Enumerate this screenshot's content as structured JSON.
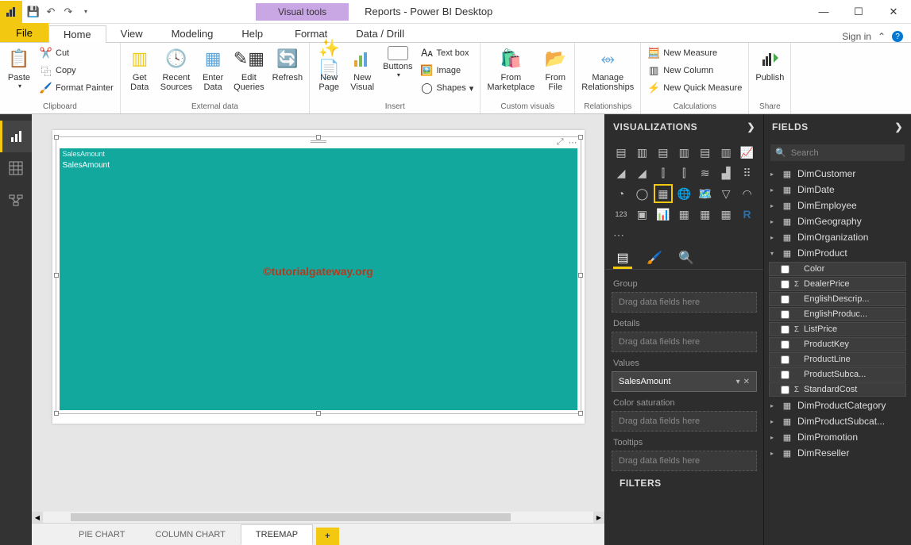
{
  "titlebar": {
    "title": "Reports - Power BI Desktop",
    "visual_tools": "Visual tools",
    "sign_in": "Sign in"
  },
  "tabs": {
    "file": "File",
    "home": "Home",
    "view": "View",
    "modeling": "Modeling",
    "help": "Help",
    "format": "Format",
    "data_drill": "Data / Drill"
  },
  "ribbon": {
    "clipboard": {
      "label": "Clipboard",
      "paste": "Paste",
      "cut": "Cut",
      "copy": "Copy",
      "fp": "Format Painter"
    },
    "external": {
      "label": "External data",
      "get": "Get\nData",
      "recent": "Recent\nSources",
      "enter": "Enter\nData",
      "edit": "Edit\nQueries",
      "refresh": "Refresh"
    },
    "insert": {
      "label": "Insert",
      "newpage": "New\nPage",
      "newvisual": "New\nVisual",
      "buttons": "Buttons",
      "textbox": "Text box",
      "image": "Image",
      "shapes": "Shapes"
    },
    "custom": {
      "label": "Custom visuals",
      "marketplace": "From\nMarketplace",
      "file": "From\nFile"
    },
    "rel": {
      "label": "Relationships",
      "manage": "Manage\nRelationships"
    },
    "calc": {
      "label": "Calculations",
      "measure": "New Measure",
      "column": "New Column",
      "quick": "New Quick Measure"
    },
    "share": {
      "label": "Share",
      "publish": "Publish"
    }
  },
  "page_tabs": [
    "PIE CHART",
    "COLUMN CHART",
    "TREEMAP"
  ],
  "treemap": {
    "title": "SalesAmount",
    "cell": "SalesAmount"
  },
  "watermark": "©tutorialgateway.org",
  "viz_panel": {
    "header": "VISUALIZATIONS",
    "wells": {
      "group": "Group",
      "details": "Details",
      "values": "Values",
      "colorsat": "Color saturation",
      "tooltips": "Tooltips",
      "placeholder": "Drag data fields here",
      "sales": "SalesAmount"
    },
    "filters": "FILTERS"
  },
  "fields_panel": {
    "header": "FIELDS",
    "search_ph": "Search",
    "tables": [
      "DimCustomer",
      "DimDate",
      "DimEmployee",
      "DimGeography",
      "DimOrganization"
    ],
    "dimproduct": "DimProduct",
    "columns": [
      {
        "name": "Color",
        "sigma": false
      },
      {
        "name": "DealerPrice",
        "sigma": true
      },
      {
        "name": "EnglishDescrip...",
        "sigma": false
      },
      {
        "name": "EnglishProduc...",
        "sigma": false
      },
      {
        "name": "ListPrice",
        "sigma": true
      },
      {
        "name": "ProductKey",
        "sigma": false
      },
      {
        "name": "ProductLine",
        "sigma": false
      },
      {
        "name": "ProductSubca...",
        "sigma": false
      },
      {
        "name": "StandardCost",
        "sigma": true
      }
    ],
    "tables2": [
      "DimProductCategory",
      "DimProductSubcat...",
      "DimPromotion",
      "DimReseller"
    ]
  }
}
